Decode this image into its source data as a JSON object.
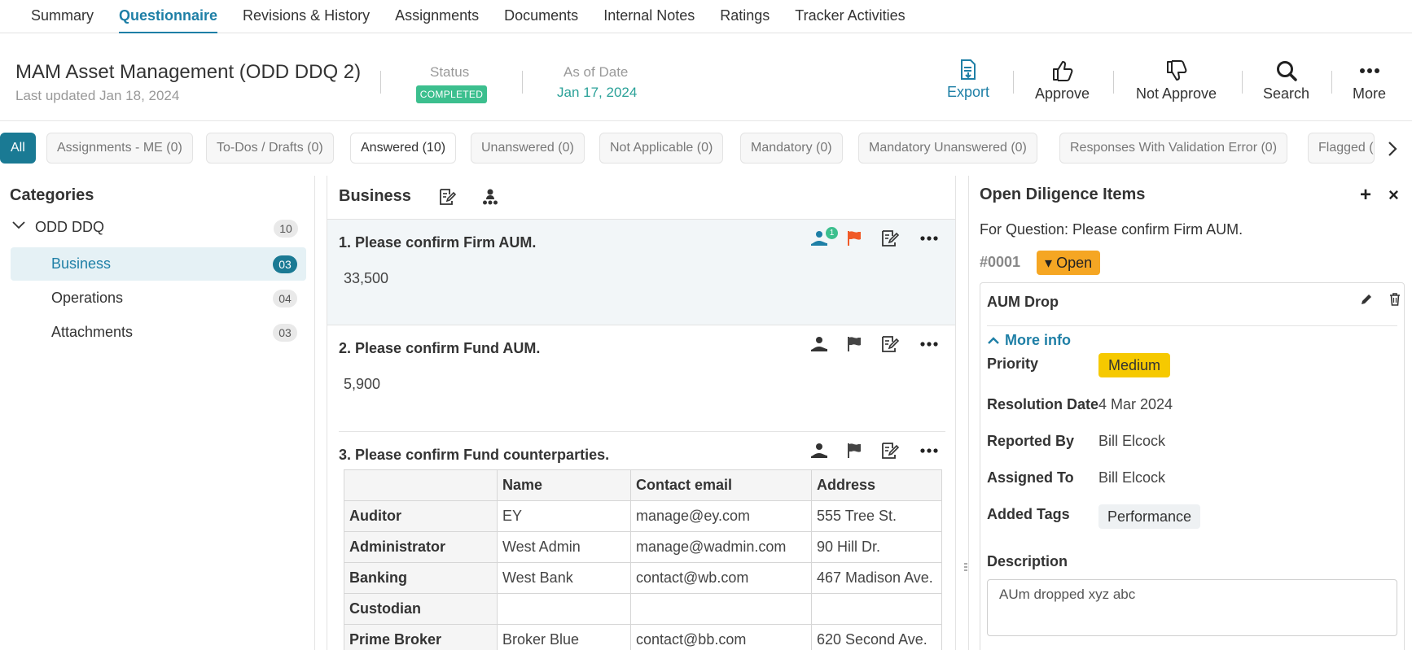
{
  "nav": {
    "tabs": [
      {
        "label": "Summary"
      },
      {
        "label": "Questionnaire"
      },
      {
        "label": "Revisions & History"
      },
      {
        "label": "Assignments"
      },
      {
        "label": "Documents"
      },
      {
        "label": "Internal Notes"
      },
      {
        "label": "Ratings"
      },
      {
        "label": "Tracker Activities"
      }
    ],
    "active_index": 1
  },
  "header": {
    "title": "MAM Asset Management (ODD DDQ 2)",
    "last_updated": "Last updated Jan 18, 2024",
    "status_label": "Status",
    "status_value": "COMPLETED",
    "date_label": "As of Date",
    "date_value": "Jan 17, 2024",
    "actions": {
      "export": "Export",
      "approve": "Approve",
      "not_approve": "Not Approve",
      "search": "Search",
      "more": "More"
    }
  },
  "filters": [
    "All",
    "Assignments - ME (0)",
    "To-Dos / Drafts (0)",
    "Answered (10)",
    "Unanswered (0)",
    "Not Applicable (0)",
    "Mandatory (0)",
    "Mandatory Unanswered (0)",
    "Responses With Validation Error (0)",
    "Flagged ("
  ],
  "categories": {
    "title": "Categories",
    "root": {
      "label": "ODD DDQ",
      "count": "10"
    },
    "items": [
      {
        "label": "Business",
        "count": "03"
      },
      {
        "label": "Operations",
        "count": "04"
      },
      {
        "label": "Attachments",
        "count": "03"
      }
    ]
  },
  "section": {
    "title": "Business",
    "questions": [
      {
        "title": "1.  Please confirm Firm AUM.",
        "answer": "33,500",
        "assign_badge": "1"
      },
      {
        "title": "2.  Please confirm Fund AUM.",
        "answer": "5,900"
      },
      {
        "title": "3.  Please confirm Fund counterparties."
      }
    ],
    "table": {
      "headers": [
        "",
        "Name",
        "Contact email",
        "Address"
      ],
      "rows": [
        [
          "Auditor",
          "EY",
          "manage@ey.com",
          "555 Tree St."
        ],
        [
          "Administrator",
          "West Admin",
          "manage@wadmin.com",
          "90 Hill Dr."
        ],
        [
          "Banking",
          "West Bank",
          "contact@wb.com",
          "467 Madison Ave."
        ],
        [
          "Custodian",
          "",
          "",
          ""
        ],
        [
          "Prime Broker",
          "Broker Blue",
          "contact@bb.com",
          "620 Second Ave."
        ]
      ]
    }
  },
  "diligence": {
    "title": "Open Diligence Items",
    "for_question": "For Question: Please confirm Firm AUM.",
    "id": "#0001",
    "status": "Open",
    "item": {
      "title": "AUM Drop",
      "more_info": "More info",
      "priority_label": "Priority",
      "priority_value": "Medium",
      "resolution_label": "Resolution Date",
      "resolution_value": "4 Mar 2024",
      "reported_label": "Reported By",
      "reported_value": "Bill Elcock",
      "assigned_label": "Assigned To",
      "assigned_value": "Bill Elcock",
      "tags_label": "Added Tags",
      "tags_value": "Performance",
      "description_label": "Description",
      "description_value": "AUm dropped xyz abc"
    }
  },
  "colors": {
    "accent": "#1e7fa6",
    "status_completed": "#3cbf8e",
    "open_badge": "#f5a623",
    "priority_medium": "#f6c900",
    "flag_active": "#f05a28"
  }
}
